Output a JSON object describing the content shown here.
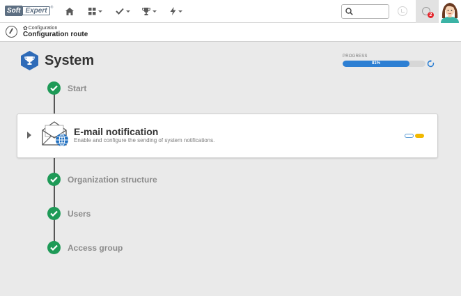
{
  "topbar": {
    "logo": {
      "part1": "Soft",
      "part2": "Expert",
      "mark": "®"
    },
    "nav": [
      {
        "name": "home",
        "icon": "home-icon"
      },
      {
        "name": "dashboard",
        "icon": "grid-icon"
      },
      {
        "name": "tasks",
        "icon": "check-icon"
      },
      {
        "name": "achievements",
        "icon": "trophy-icon"
      },
      {
        "name": "actions",
        "icon": "bolt-icon"
      }
    ],
    "search": {
      "value": "",
      "placeholder": ""
    },
    "notifications": {
      "count": "2"
    }
  },
  "breadcrumb": {
    "parent": "Configuration",
    "title": "Configuration route"
  },
  "main": {
    "title": "System",
    "progress": {
      "label": "PROGRESS",
      "value": 81,
      "text": "81%"
    },
    "steps": [
      {
        "label": "Start",
        "status": "done"
      },
      {
        "label": "Organization structure",
        "status": "done"
      },
      {
        "label": "Users",
        "status": "done"
      },
      {
        "label": "Access group",
        "status": "done"
      }
    ],
    "card": {
      "title": "E-mail notification",
      "description": "Enable and configure the sending of system notifications."
    }
  },
  "colors": {
    "accent": "#2d7fd3",
    "success": "#1e9a57",
    "warning": "#f1b800",
    "brand": "#5d6f82",
    "badge": "#e3242b"
  }
}
